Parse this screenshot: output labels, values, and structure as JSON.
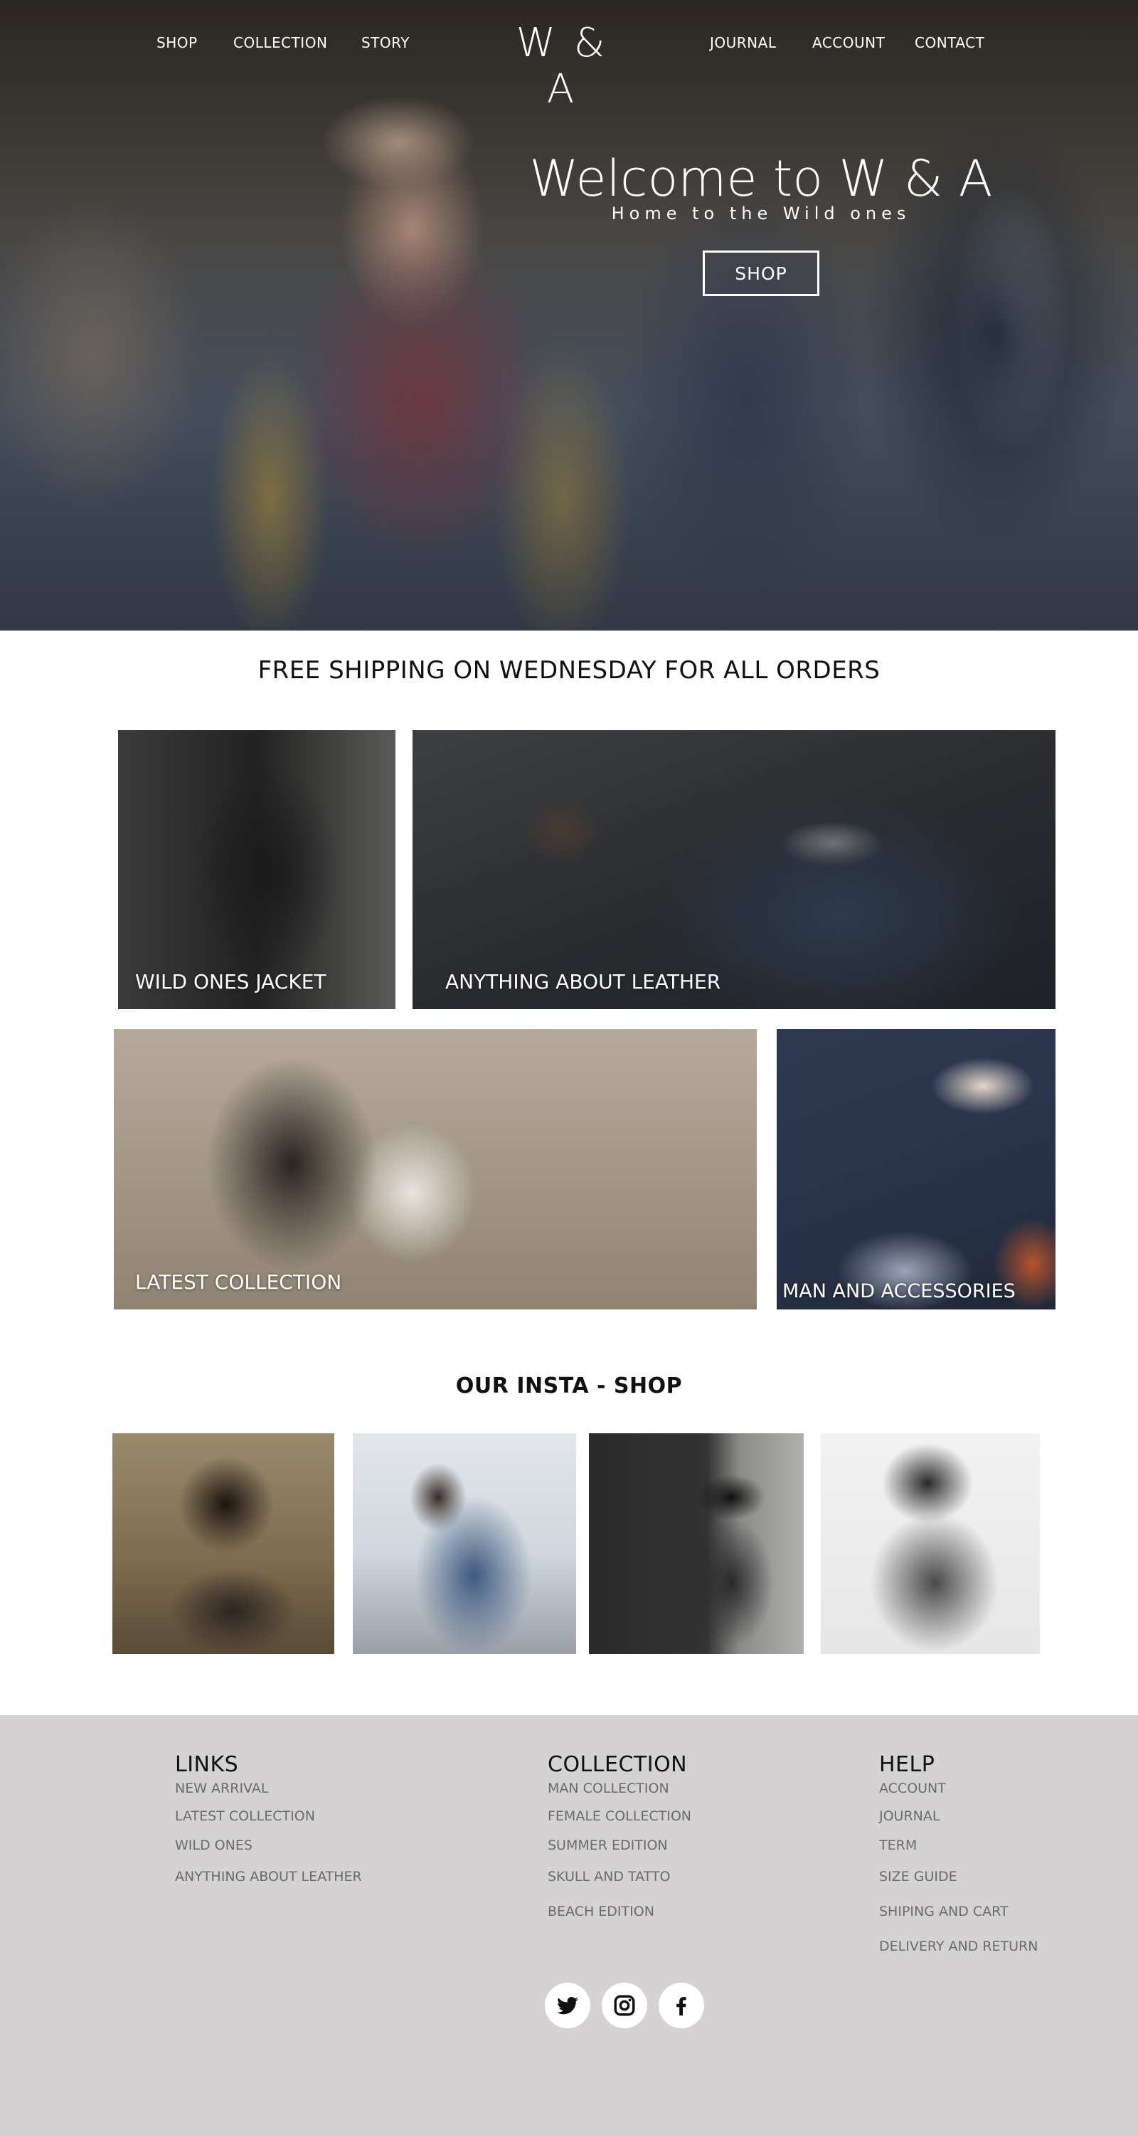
{
  "nav": {
    "left": [
      "SHOP",
      "COLLECTION",
      "STORY"
    ],
    "logo": "W & A",
    "right": [
      "JOURNAL",
      "ACCOUNT",
      "CONTACT"
    ]
  },
  "hero": {
    "title": "Welcome to W & A",
    "subtitle": "Home to the Wild ones",
    "button_label": "SHOP"
  },
  "shipping_banner": "FREE SHIPPING ON WEDNESDAY FOR ALL ORDERS",
  "categories": [
    {
      "label": "WILD ONES JACKET"
    },
    {
      "label": "ANYTHING ABOUT LEATHER"
    },
    {
      "label": "LATEST COLLECTION"
    },
    {
      "label": "MAN AND ACCESSORIES"
    }
  ],
  "insta": {
    "title": "OUR INSTA - SHOP"
  },
  "footer": {
    "links": {
      "heading": "LINKS",
      "items": [
        "NEW ARRIVAL",
        "LATEST COLLECTION",
        "WILD ONES",
        "ANYTHING ABOUT LEATHER"
      ]
    },
    "collection": {
      "heading": "COLLECTION",
      "items": [
        "MAN COLLECTION",
        "FEMALE COLLECTION",
        "SUMMER EDITION",
        "SKULL AND TATTO",
        "BEACH EDITION"
      ]
    },
    "help": {
      "heading": "HELP",
      "items": [
        "ACCOUNT",
        "JOURNAL",
        "TERM",
        "SIZE GUIDE",
        "SHIPING AND CART",
        "DELIVERY AND RETURN"
      ]
    },
    "social_icons": [
      "twitter-icon",
      "instagram-icon",
      "facebook-icon"
    ]
  },
  "colors": {
    "footer_bg": "#d4d2d3",
    "footer_link": "#6b6b6b",
    "text_dark": "#111111"
  }
}
